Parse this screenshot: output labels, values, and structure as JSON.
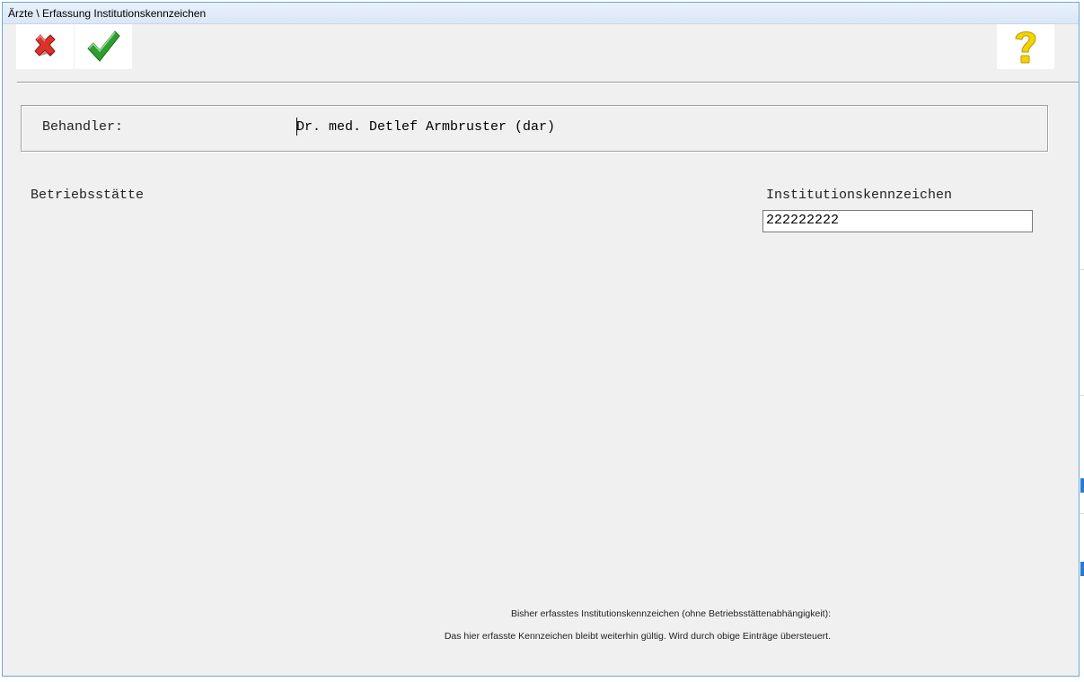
{
  "window": {
    "title": "Ärzte \\ Erfassung Institutionskennzeichen"
  },
  "toolbar": {
    "cancel_icon": "red-x-icon",
    "confirm_icon": "green-check-icon",
    "help_icon": "yellow-question-icon"
  },
  "behandler": {
    "label": "Behandler:",
    "value": "Dr. med. Detlef Armbruster (dar)"
  },
  "betriebsstaette": {
    "label": "Betriebsstätte"
  },
  "institutionskennzeichen": {
    "label": "Institutionskennzeichen",
    "value": "222222222"
  },
  "info": {
    "line1": "Bisher erfasstes Institutionskennzeichen (ohne Betriebsstättenabhängigkeit):",
    "line2": "Das hier erfasste Kennzeichen bleibt weiterhin gültig. Wird durch obige Einträge übersteuert."
  },
  "colors": {
    "window_bg": "#f0f0f0",
    "cancel": "#d9342b",
    "confirm": "#2f9e2f",
    "help": "#f2d400"
  }
}
